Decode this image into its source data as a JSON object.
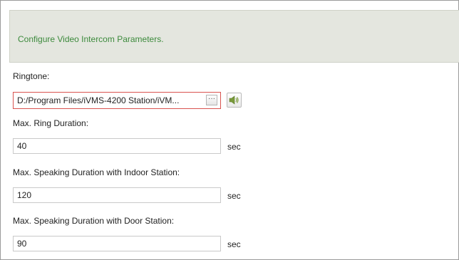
{
  "header": {
    "text": "Configure Video Intercom Parameters."
  },
  "ringtone": {
    "label": "Ringtone:",
    "value": "D:/Program Files/iVMS-4200 Station/iVM...",
    "browse_label": "···",
    "play_icon": "speaker-icon"
  },
  "max_ring_duration": {
    "label": "Max. Ring Duration:",
    "value": "40",
    "unit": "sec"
  },
  "max_speaking_indoor": {
    "label": "Max. Speaking Duration with Indoor Station:",
    "value": "120",
    "unit": "sec"
  },
  "max_speaking_door": {
    "label": "Max. Speaking Duration with Door Station:",
    "value": "90",
    "unit": "sec"
  },
  "colors": {
    "header_bg": "#e4e6df",
    "header_text": "#3c8a3c",
    "ringtone_border": "#d9534f"
  }
}
